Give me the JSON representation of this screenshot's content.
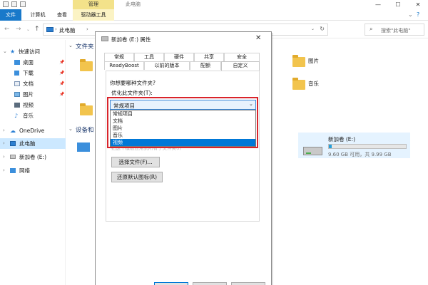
{
  "window": {
    "context_tab": "管理",
    "title": "此电脑",
    "ribbon_tabs": [
      "文件",
      "计算机",
      "查看",
      "驱动器工具"
    ],
    "minimize": "—",
    "maximize": "☐",
    "close": "✕",
    "help": "?"
  },
  "address": {
    "path": "此电脑",
    "separator": "›",
    "search_placeholder": "搜索\"此电脑\""
  },
  "nav": {
    "quick_access": "快速访问",
    "quick_items": [
      "桌面",
      "下载",
      "文档",
      "图片",
      "视频",
      "音乐"
    ],
    "onedrive": "OneDrive",
    "this_pc": "此电脑",
    "new_volume": "新加卷 (E:)",
    "network": "网络"
  },
  "content": {
    "folders_header": "文件夹",
    "devices_header": "设备和",
    "right_folders": [
      "图片",
      "音乐"
    ],
    "drive": {
      "name": "新加卷 (E:)",
      "free_text": "9.60 GB 可用，共 9.99 GB",
      "used_fraction": 0.04
    }
  },
  "dialog": {
    "title": "新加卷 (E:) 属性",
    "close": "✕",
    "tabs_row1": [
      "常规",
      "工具",
      "硬件",
      "共享",
      "安全"
    ],
    "tabs_row2": [
      "ReadyBoost",
      "以前的版本",
      "配额",
      "自定义"
    ],
    "active_tab": "自定义",
    "question": "你想要哪种文件夹?",
    "optimize_label": "优化此文件夹(T):",
    "selected": "常规项目",
    "options": [
      "常规项目",
      "文档",
      "图片",
      "音乐",
      "视频"
    ],
    "highlighted_option": "视频",
    "hint": "把这个模板应用到所有子文件夹(I)",
    "choose_file": "选择文件(F)...",
    "restore_icon": "还原默认图标(R)"
  }
}
